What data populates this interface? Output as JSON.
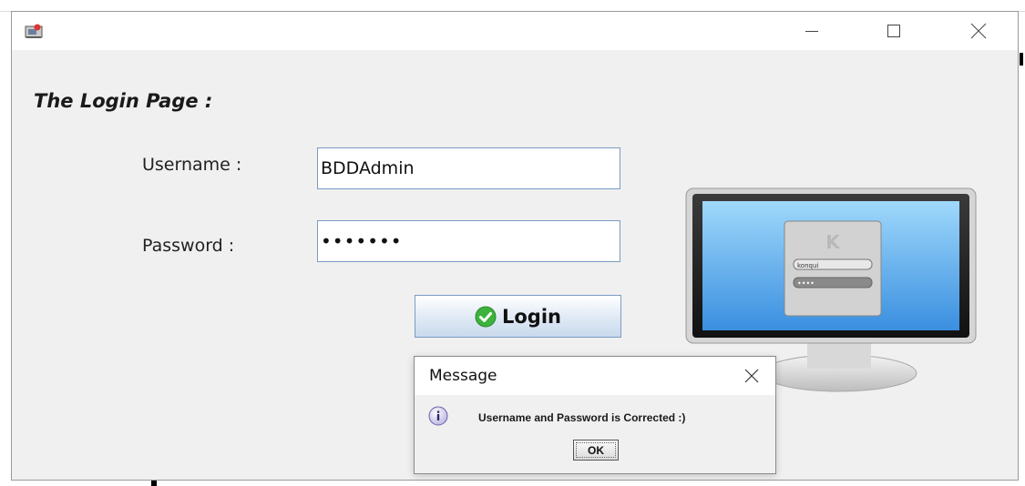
{
  "window": {
    "title": "",
    "controls": {
      "minimize": "minimize-icon",
      "maximize": "maximize-icon",
      "close": "close-icon"
    }
  },
  "login": {
    "page_title": "The Login Page :",
    "username_label": "Username :",
    "username_value": "BDDAdmin",
    "password_label": "Password :",
    "password_value": "•••••••",
    "login_label": "Login",
    "login_icon": "check-icon"
  },
  "illustration": {
    "name": "monitor-login-illustration",
    "screen_username": "konqui",
    "screen_password": "••••"
  },
  "dialog": {
    "title": "Message",
    "message": "Username and Password is Corrected :)",
    "ok_label": "OK",
    "icon": "info-icon"
  },
  "colors": {
    "window_bg": "#f0f0f0",
    "field_border": "#7a9cc6",
    "check_green": "#3cb33c"
  }
}
